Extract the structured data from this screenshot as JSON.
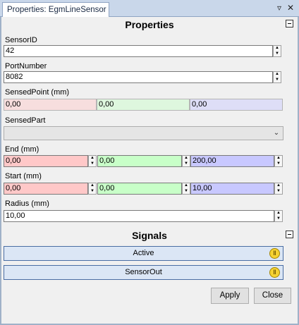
{
  "window": {
    "tab_title": "Properties: EgmLineSensor",
    "pin_icon": "pin-icon",
    "close_icon": "close-icon"
  },
  "properties": {
    "header": "Properties",
    "sensor_id": {
      "label": "SensorID",
      "value": "42"
    },
    "port_number": {
      "label": "PortNumber",
      "value": "8082"
    },
    "sensed_point": {
      "label": "SensedPoint (mm)",
      "x": "0,00",
      "y": "0,00",
      "z": "0,00"
    },
    "sensed_part": {
      "label": "SensedPart",
      "value": ""
    },
    "end": {
      "label": "End (mm)",
      "x": "0,00",
      "y": "0,00",
      "z": "200,00"
    },
    "start": {
      "label": "Start (mm)",
      "x": "0,00",
      "y": "0,00",
      "z": "10,00"
    },
    "radius": {
      "label": "Radius (mm)",
      "value": "10,00"
    }
  },
  "signals": {
    "header": "Signals",
    "items": [
      {
        "label": "Active"
      },
      {
        "label": "SensorOut"
      }
    ]
  },
  "buttons": {
    "apply": "Apply",
    "close": "Close"
  },
  "colors": {
    "x_axis": "#ffc8c8",
    "y_axis": "#c8ffc8",
    "z_axis": "#c8c8ff",
    "signal_indicator": "#f5d232"
  }
}
